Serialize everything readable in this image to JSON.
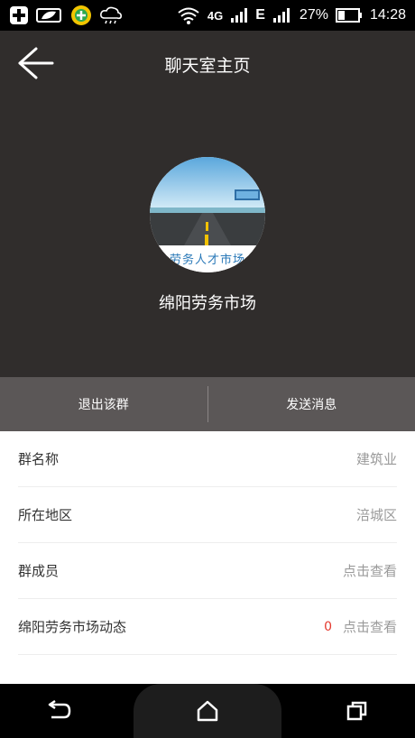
{
  "status_bar": {
    "battery_percent": "27%",
    "time": "14:28",
    "network_4g": "4G",
    "network_e": "E"
  },
  "header": {
    "title": "聊天室主页",
    "avatar_caption": "劳务人才市场",
    "group_name": "绵阳劳务市场"
  },
  "actions": {
    "leave": "退出该群",
    "send": "发送消息"
  },
  "info": [
    {
      "label": "群名称",
      "value": "建筑业"
    },
    {
      "label": "所在地区",
      "value": "涪城区"
    },
    {
      "label": "群成员",
      "value": "点击查看"
    },
    {
      "label": "绵阳劳务市场动态",
      "count": "0",
      "value": "点击查看"
    }
  ],
  "colors": {
    "header_bg": "#302d2c",
    "action_bar_bg": "#5b5757",
    "count_red": "#e4392e",
    "caption_blue": "#2a79b8"
  }
}
